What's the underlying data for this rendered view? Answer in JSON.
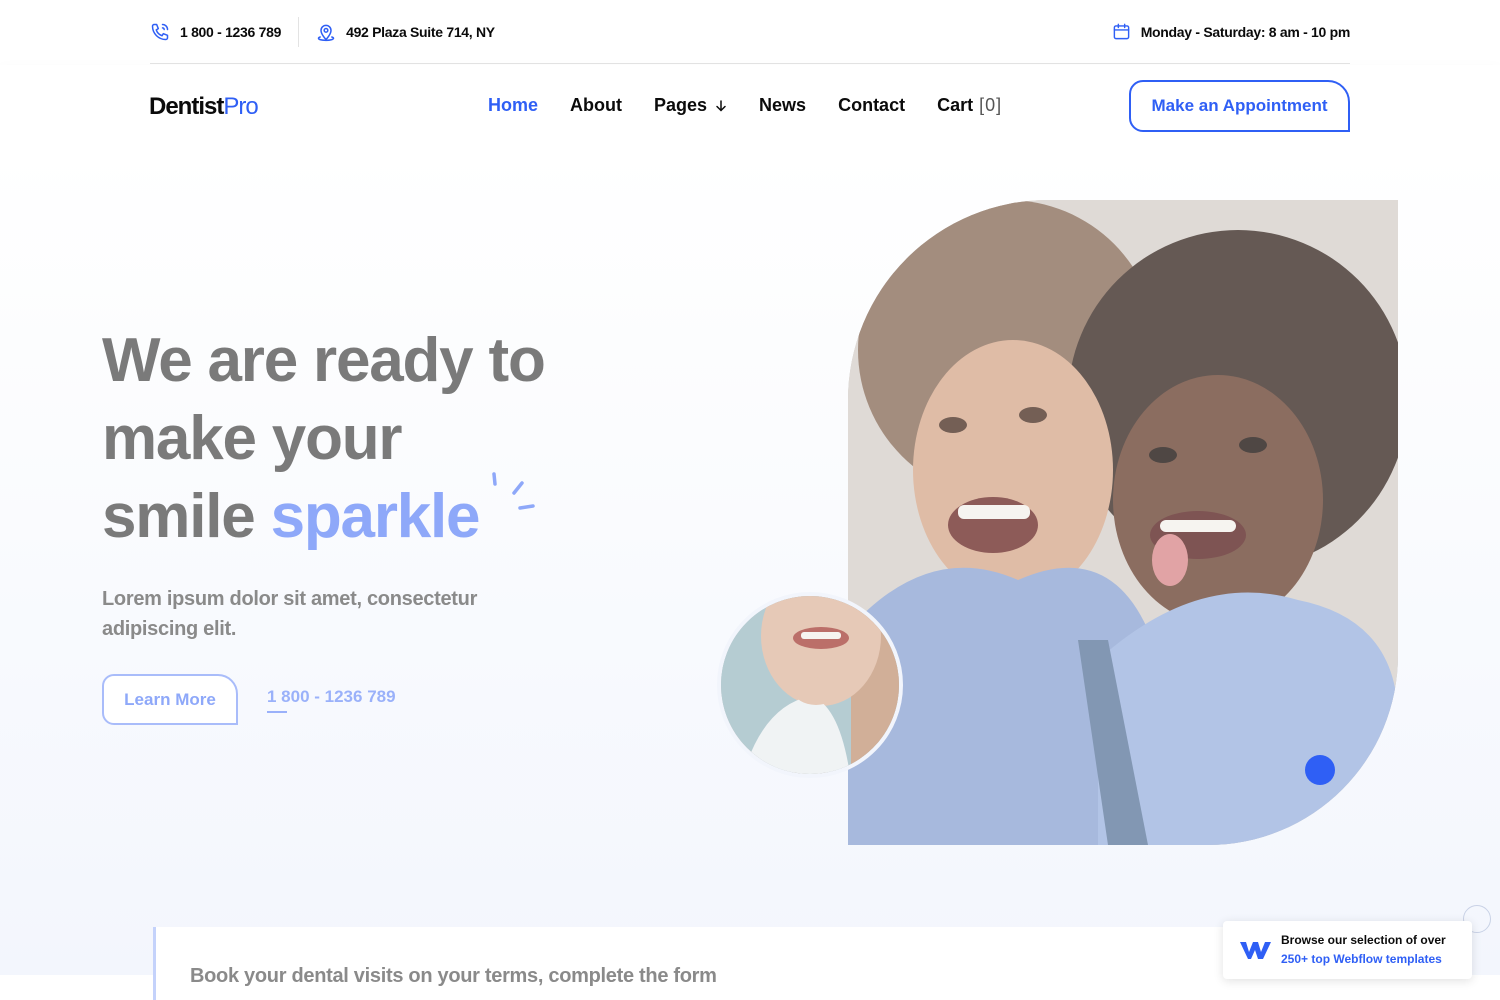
{
  "topbar": {
    "phone": "1 800 - 1236 789",
    "address": "492 Plaza Suite 714, NY",
    "hours": "Monday - Saturday: 8 am - 10 pm"
  },
  "nav": {
    "logo_main": "Dentist",
    "logo_accent": "Pro",
    "items": [
      "Home",
      "About",
      "Pages",
      "News",
      "Contact"
    ],
    "cart_label": "Cart",
    "cart_count": "[0]",
    "cta": "Make an Appointment"
  },
  "hero": {
    "title_line1": "We are ready to",
    "title_line2": "make your",
    "title_line3_plain": "smile ",
    "title_line3_accent": "sparkle",
    "subtitle": "Lorem ipsum dolor sit amet, consectetur adipiscing elit.",
    "learn_more": "Learn More",
    "phone": "1 800 - 1236 789"
  },
  "booking": {
    "text": "Book your dental visits on your terms, complete the form"
  },
  "badge": {
    "line1": "Browse our selection of over",
    "line2": "250+ top Webflow templates"
  },
  "colors": {
    "accent": "#2f5ff5",
    "accent_light": "#8ea8f9",
    "text": "#0b0b0b"
  }
}
